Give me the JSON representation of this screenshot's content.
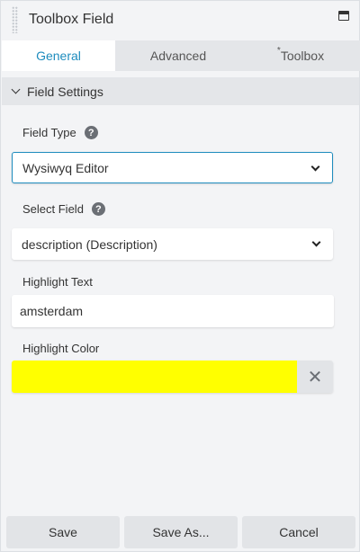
{
  "window": {
    "title": "Toolbox Field"
  },
  "tabs": [
    {
      "label": "General",
      "active": true
    },
    {
      "label": "Advanced",
      "active": false
    },
    {
      "label": "Toolbox",
      "modified_marker": "*",
      "active": false
    }
  ],
  "section": {
    "label": "Field Settings"
  },
  "field_type": {
    "label": "Field Type",
    "help": "?",
    "value": "Wysiwyq Editor"
  },
  "select_field": {
    "label": "Select Field",
    "help": "?",
    "value": "description (Description)"
  },
  "highlight_text": {
    "label": "Highlight Text",
    "value": "amsterdam"
  },
  "highlight_color": {
    "label": "Highlight Color",
    "value": "#ffff00",
    "clear": "✕"
  },
  "footer": {
    "save": "Save",
    "save_as": "Save As...",
    "cancel": "Cancel"
  },
  "colors": {
    "accent": "#1e8cbe",
    "panel_bg": "#f3f4f6",
    "tab_bg": "#e4e6e9",
    "button_bg": "#e2e4e7"
  }
}
